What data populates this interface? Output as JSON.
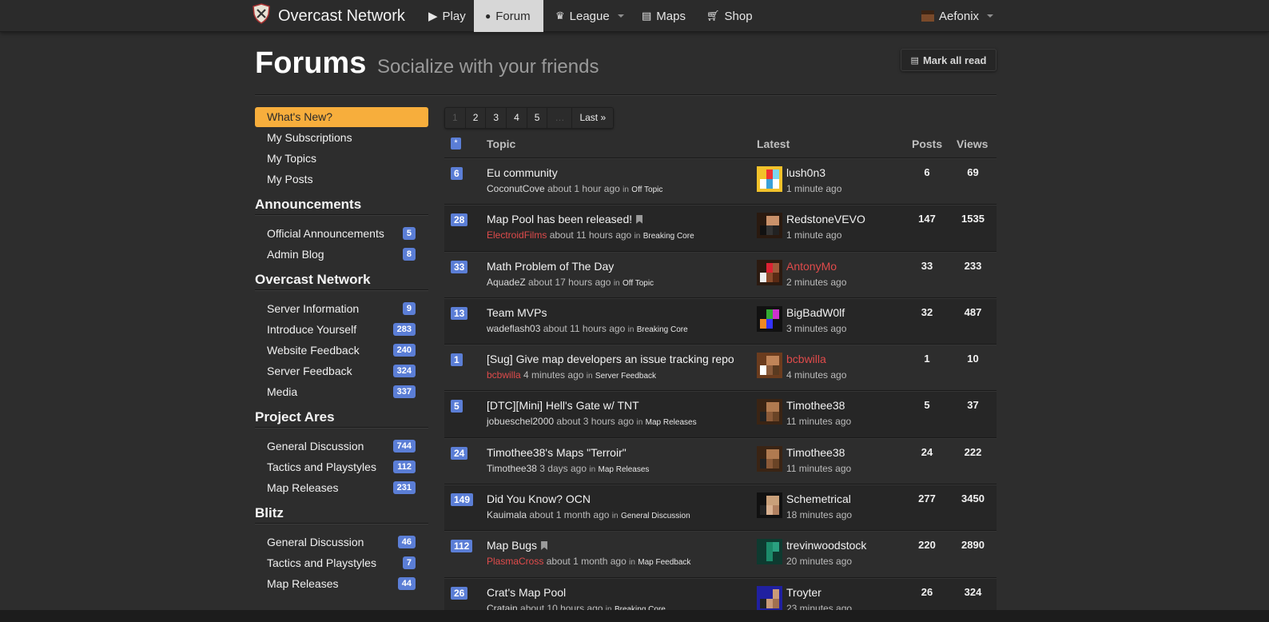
{
  "nav": {
    "brand": "Overcast Network",
    "items": [
      {
        "label": "Play",
        "icon": "play-icon"
      },
      {
        "label": "Forum",
        "icon": "comments-icon",
        "active": true
      },
      {
        "label": "League",
        "icon": "trophy-icon",
        "dropdown": true
      },
      {
        "label": "Maps",
        "icon": "map-icon"
      },
      {
        "label": "Shop",
        "icon": "cart-icon"
      }
    ],
    "user": "Aefonix"
  },
  "header": {
    "title": "Forums",
    "subtitle": "Socialize with your friends",
    "mark_all_read": "Mark all read"
  },
  "sidebar": {
    "active": "What's New?",
    "links": [
      "My Subscriptions",
      "My Topics",
      "My Posts"
    ],
    "sections": [
      {
        "heading": "Announcements",
        "items": [
          {
            "label": "Official Announcements",
            "count": "5"
          },
          {
            "label": "Admin Blog",
            "count": "8"
          }
        ]
      },
      {
        "heading": "Overcast Network",
        "items": [
          {
            "label": "Server Information",
            "count": "9"
          },
          {
            "label": "Introduce Yourself",
            "count": "283"
          },
          {
            "label": "Website Feedback",
            "count": "240"
          },
          {
            "label": "Server Feedback",
            "count": "324"
          },
          {
            "label": "Media",
            "count": "337"
          }
        ]
      },
      {
        "heading": "Project Ares",
        "items": [
          {
            "label": "General Discussion",
            "count": "744"
          },
          {
            "label": "Tactics and Playstyles",
            "count": "112"
          },
          {
            "label": "Map Releases",
            "count": "231"
          }
        ]
      },
      {
        "heading": "Blitz",
        "items": [
          {
            "label": "General Discussion",
            "count": "46"
          },
          {
            "label": "Tactics and Playstyles",
            "count": "7"
          },
          {
            "label": "Map Releases",
            "count": "44"
          }
        ]
      }
    ]
  },
  "pagination": {
    "pages": [
      "1",
      "2",
      "3",
      "4",
      "5",
      "…",
      "Last »"
    ]
  },
  "table": {
    "headers": {
      "star": "*",
      "topic": "Topic",
      "latest": "Latest",
      "posts": "Posts",
      "views": "Views"
    },
    "rows": [
      {
        "badge": "6",
        "title": "Eu community",
        "bookmark": false,
        "author": "CoconutCove",
        "author_red": false,
        "ago": "about 1 hour ago",
        "in": "in",
        "forum": "Off Topic",
        "latest_user": "lush0n3",
        "latest_red": false,
        "latest_time": "1 minute ago",
        "posts": "6",
        "views": "69",
        "avatar": "avatar-lush"
      },
      {
        "badge": "28",
        "title": "Map Pool has been released!",
        "bookmark": true,
        "author": "ElectroidFilms",
        "author_red": true,
        "ago": "about 11 hours ago",
        "in": "in",
        "forum": "Breaking Core",
        "latest_user": "RedstoneVEVO",
        "latest_red": false,
        "latest_time": "1 minute ago",
        "posts": "147",
        "views": "1535",
        "avatar": "avatar-redstone"
      },
      {
        "badge": "33",
        "title": "Math Problem of The Day",
        "bookmark": false,
        "author": "AquadeZ",
        "author_red": false,
        "ago": "about 17 hours ago",
        "in": "in",
        "forum": "Off Topic",
        "latest_user": "AntonyMo",
        "latest_red": true,
        "latest_time": "2 minutes ago",
        "posts": "33",
        "views": "233",
        "avatar": "avatar-antony"
      },
      {
        "badge": "13",
        "title": "Team MVPs",
        "bookmark": false,
        "author": "wadeflash03",
        "author_red": false,
        "ago": "about 11 hours ago",
        "in": "in",
        "forum": "Breaking Core",
        "latest_user": "BigBadW0lf",
        "latest_red": false,
        "latest_time": "3 minutes ago",
        "posts": "32",
        "views": "487",
        "avatar": "avatar-bigbad"
      },
      {
        "badge": "1",
        "title": "[Sug] Give map developers an issue tracking repo",
        "bookmark": false,
        "author": "bcbwilla",
        "author_red": true,
        "ago": "4 minutes ago",
        "in": "in",
        "forum": "Server Feedback",
        "latest_user": "bcbwilla",
        "latest_red": true,
        "latest_time": "4 minutes ago",
        "posts": "1",
        "views": "10",
        "avatar": "avatar-bcb"
      },
      {
        "badge": "5",
        "title": "[DTC][Mini] Hell's Gate w/ TNT",
        "bookmark": false,
        "author": "jobueschel2000",
        "author_red": false,
        "ago": "about 3 hours ago",
        "in": "in",
        "forum": "Map Releases",
        "latest_user": "Timothee38",
        "latest_red": false,
        "latest_time": "11 minutes ago",
        "posts": "5",
        "views": "37",
        "avatar": "avatar-tim"
      },
      {
        "badge": "24",
        "title": "Timothee38's Maps \"Terroir\"",
        "bookmark": false,
        "author": "Timothee38",
        "author_red": false,
        "ago": "3 days ago",
        "in": "in",
        "forum": "Map Releases",
        "latest_user": "Timothee38",
        "latest_red": false,
        "latest_time": "11 minutes ago",
        "posts": "24",
        "views": "222",
        "avatar": "avatar-tim"
      },
      {
        "badge": "149",
        "title": "Did You Know? OCN",
        "bookmark": false,
        "author": "Kauimala",
        "author_red": false,
        "ago": "about 1 month ago",
        "in": "in",
        "forum": "General Discussion",
        "latest_user": "Schemetrical",
        "latest_red": false,
        "latest_time": "18 minutes ago",
        "posts": "277",
        "views": "3450",
        "avatar": "avatar-schem"
      },
      {
        "badge": "112",
        "title": "Map Bugs",
        "bookmark": true,
        "author": "PlasmaCross",
        "author_red": true,
        "ago": "about 1 month ago",
        "in": "in",
        "forum": "Map Feedback",
        "latest_user": "trevinwoodstock",
        "latest_red": false,
        "latest_time": "20 minutes ago",
        "posts": "220",
        "views": "2890",
        "avatar": "avatar-trevin"
      },
      {
        "badge": "26",
        "title": "Crat's Map Pool",
        "bookmark": false,
        "author": "Cratain",
        "author_red": false,
        "ago": "about 10 hours ago",
        "in": "in",
        "forum": "Breaking Core",
        "latest_user": "Troyter",
        "latest_red": false,
        "latest_time": "23 minutes ago",
        "posts": "26",
        "views": "324",
        "avatar": "avatar-troyter"
      }
    ]
  },
  "colors": {
    "background": "#2d2d2d",
    "accent": "#f7ae3c",
    "badge": "#5b7ed6",
    "red_user": "#e04b4b"
  }
}
